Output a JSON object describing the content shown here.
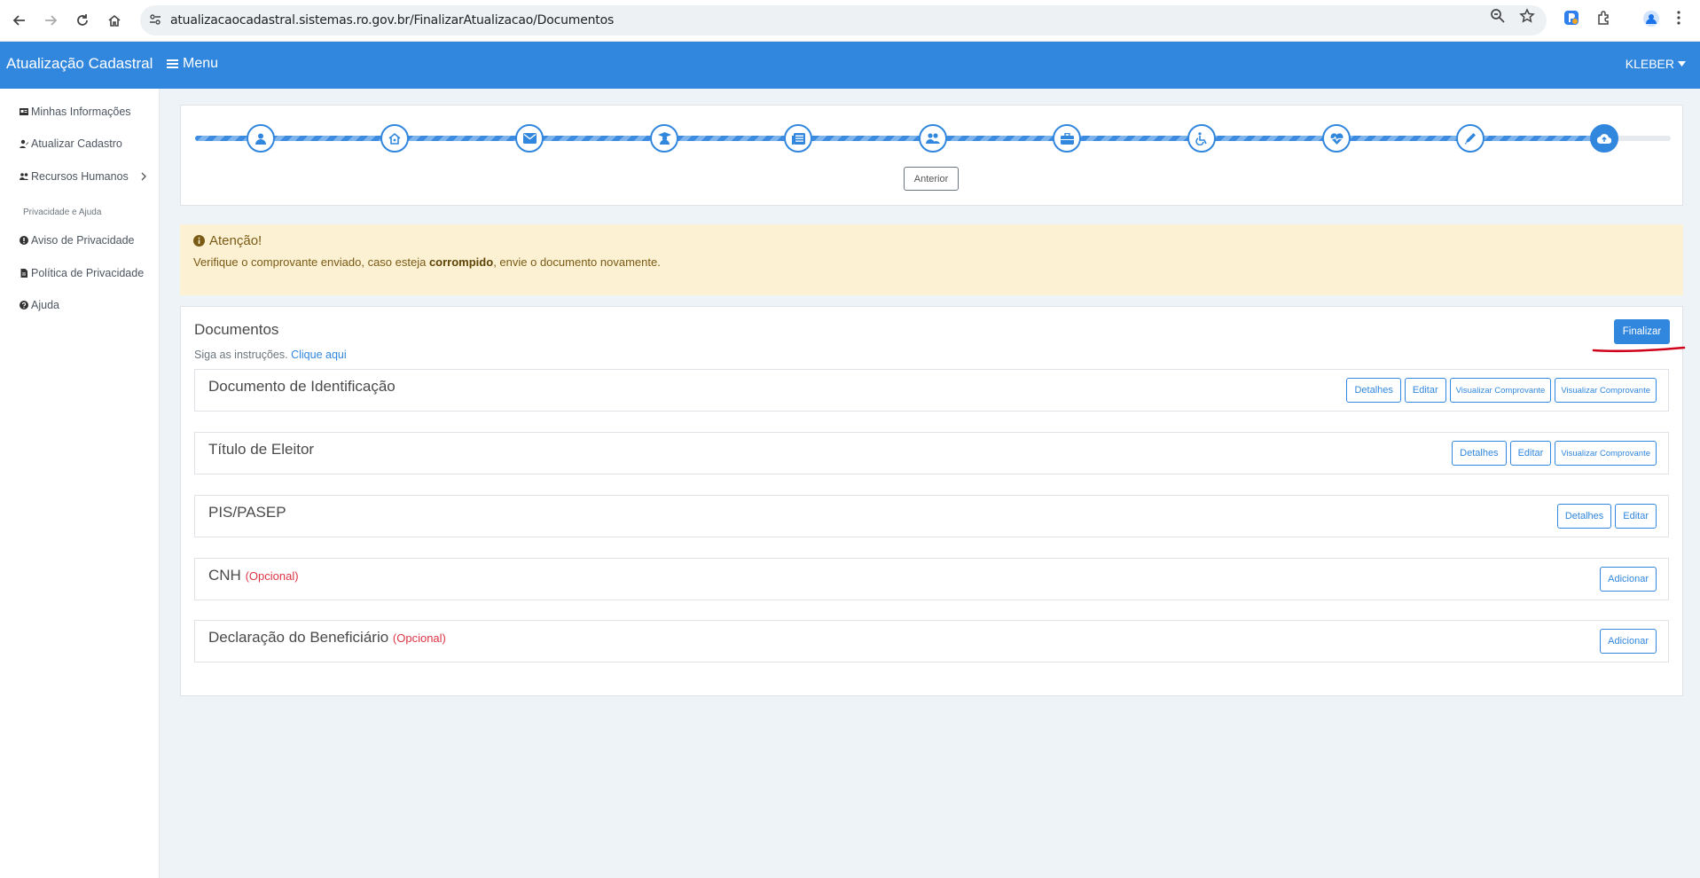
{
  "browser": {
    "url": "atualizacaocadastral.sistemas.ro.gov.br/FinalizarAtualizacao/Documentos"
  },
  "header": {
    "brand": "Atualização Cadastral",
    "menu_label": "Menu",
    "user_name": "KLEBER"
  },
  "sidebar": {
    "items": [
      {
        "label": "Minhas Informações",
        "icon": "id-card-icon"
      },
      {
        "label": "Atualizar Cadastro",
        "icon": "user-edit-icon"
      },
      {
        "label": "Recursos Humanos",
        "icon": "users-icon"
      }
    ],
    "section_title": "Privacidade e Ajuda",
    "help_items": [
      {
        "label": "Aviso de Privacidade",
        "icon": "exclamation-circle-icon"
      },
      {
        "label": "Política de Privacidade",
        "icon": "file-icon"
      },
      {
        "label": "Ajuda",
        "icon": "question-circle-icon"
      }
    ]
  },
  "stepper": {
    "steps": [
      "user",
      "home",
      "envelope",
      "graduate",
      "newspaper",
      "users",
      "briefcase",
      "wheelchair",
      "heart-pulse",
      "pencil",
      "cloud-upload"
    ],
    "active_index": 10,
    "back_label": "Anterior"
  },
  "alert": {
    "title": "Atenção!",
    "text_before": "Verifique o comprovante enviado, caso esteja ",
    "text_bold": "corrompido",
    "text_after": ", envie o documento novamente."
  },
  "documents": {
    "title": "Documentos",
    "instructions": "Siga as instruções.",
    "instructions_link": "Clique aqui",
    "finish_label": "Finalizar",
    "rows": [
      {
        "name": "Documento de Identificação",
        "optional": "",
        "buttons": [
          "Detalhes",
          "Editar",
          "Visualizar Comprovante",
          "Visualizar Comprovante"
        ]
      },
      {
        "name": "Título de Eleitor",
        "optional": "",
        "buttons": [
          "Detalhes",
          "Editar",
          "Visualizar Comprovante"
        ]
      },
      {
        "name": "PIS/PASEP",
        "optional": "",
        "buttons": [
          "Detalhes",
          "Editar"
        ]
      },
      {
        "name": "CNH",
        "optional": "(Opcional)",
        "buttons": [
          "Adicionar"
        ]
      },
      {
        "name": "Declaração do Beneficiário",
        "optional": "(Opcional)",
        "buttons": [
          "Adicionar"
        ]
      }
    ]
  },
  "colors": {
    "primary": "#3187dd",
    "alert_bg": "#fdf1d3",
    "optional": "#dc3545",
    "annotation": "#d0021b"
  }
}
